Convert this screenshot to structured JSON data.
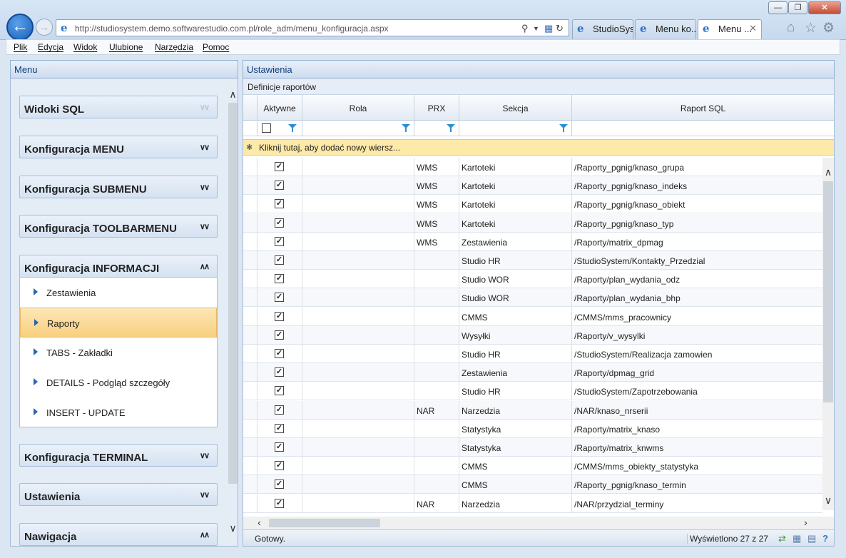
{
  "browser": {
    "url": "http://studiosystem.demo.softwarestudio.com.pl/role_adm/menu_konfiguracja.aspx",
    "tabs": [
      {
        "label": "StudioSys...",
        "active": false
      },
      {
        "label": "Menu ko...",
        "active": false
      },
      {
        "label": "Menu ...",
        "active": true
      }
    ],
    "window_buttons": {
      "minimize": "—",
      "maximize": "❐",
      "close": "✕"
    }
  },
  "menubar": [
    "Plik",
    "Edycja",
    "Widok",
    "Ulubione",
    "Narzędzia",
    "Pomoc"
  ],
  "left_panel": {
    "title": "Menu",
    "sections": [
      {
        "label": "Widoki SQL",
        "state": "collapsed"
      },
      {
        "label": "Konfiguracja MENU",
        "state": "collapsed"
      },
      {
        "label": "Konfiguracja SUBMENU",
        "state": "collapsed"
      },
      {
        "label": "Konfiguracja TOOLBARMENU",
        "state": "collapsed"
      },
      {
        "label": "Konfiguracja INFORMACJI",
        "state": "expanded"
      },
      {
        "label": "Konfiguracja TERMINAL",
        "state": "collapsed"
      },
      {
        "label": "Ustawienia",
        "state": "collapsed"
      },
      {
        "label": "Nawigacja",
        "state": "expanded"
      }
    ],
    "open_items": [
      {
        "label": "Zestawienia",
        "selected": false
      },
      {
        "label": "Raporty",
        "selected": true
      },
      {
        "label": "TABS - Zakładki",
        "selected": false
      },
      {
        "label": "DETAILS - Podgląd szczegóły",
        "selected": false
      },
      {
        "label": "INSERT - UPDATE",
        "selected": false
      }
    ]
  },
  "right_panel": {
    "title": "Ustawienia",
    "grid_caption": "Definicje raportów",
    "columns": [
      "Aktywne",
      "Rola",
      "PRX",
      "Sekcja",
      "Raport SQL"
    ],
    "new_row_text": "Kliknij tutaj, aby dodać nowy wiersz...",
    "rows": [
      {
        "aktywne": true,
        "rola": "",
        "prx": "WMS",
        "sekcja": "Kartoteki",
        "raport": "/Raporty_pgnig/knaso_grupa"
      },
      {
        "aktywne": true,
        "rola": "",
        "prx": "WMS",
        "sekcja": "Kartoteki",
        "raport": "/Raporty_pgnig/knaso_indeks"
      },
      {
        "aktywne": true,
        "rola": "",
        "prx": "WMS",
        "sekcja": "Kartoteki",
        "raport": "/Raporty_pgnig/knaso_obiekt"
      },
      {
        "aktywne": true,
        "rola": "",
        "prx": "WMS",
        "sekcja": "Kartoteki",
        "raport": "/Raporty_pgnig/knaso_typ"
      },
      {
        "aktywne": true,
        "rola": "",
        "prx": "WMS",
        "sekcja": "Zestawienia",
        "raport": "/Raporty/matrix_dpmag"
      },
      {
        "aktywne": true,
        "rola": "",
        "prx": "",
        "sekcja": "Studio HR",
        "raport": "/StudioSystem/Kontakty_Przedzial"
      },
      {
        "aktywne": true,
        "rola": "",
        "prx": "",
        "sekcja": "Studio WOR",
        "raport": "/Raporty/plan_wydania_odz"
      },
      {
        "aktywne": true,
        "rola": "",
        "prx": "",
        "sekcja": "Studio WOR",
        "raport": "/Raporty/plan_wydania_bhp"
      },
      {
        "aktywne": true,
        "rola": "",
        "prx": "",
        "sekcja": "CMMS",
        "raport": "/CMMS/mms_pracownicy"
      },
      {
        "aktywne": true,
        "rola": "",
        "prx": "",
        "sekcja": "Wysyłki",
        "raport": "/Raporty/v_wysylki"
      },
      {
        "aktywne": true,
        "rola": "",
        "prx": "",
        "sekcja": "Studio HR",
        "raport": "/StudioSystem/Realizacja zamowien"
      },
      {
        "aktywne": true,
        "rola": "",
        "prx": "",
        "sekcja": "Zestawienia",
        "raport": "/Raporty/dpmag_grid"
      },
      {
        "aktywne": true,
        "rola": "",
        "prx": "",
        "sekcja": "Studio HR",
        "raport": "/StudioSystem/Zapotrzebowania"
      },
      {
        "aktywne": true,
        "rola": "",
        "prx": "NAR",
        "sekcja": "Narzedzia",
        "raport": "/NAR/knaso_nrserii"
      },
      {
        "aktywne": true,
        "rola": "",
        "prx": "",
        "sekcja": "Statystyka",
        "raport": "/Raporty/matrix_knaso"
      },
      {
        "aktywne": true,
        "rola": "",
        "prx": "",
        "sekcja": "Statystyka",
        "raport": "/Raporty/matrix_knwms"
      },
      {
        "aktywne": true,
        "rola": "",
        "prx": "",
        "sekcja": "CMMS",
        "raport": "/CMMS/mms_obiekty_statystyka"
      },
      {
        "aktywne": true,
        "rola": "",
        "prx": "",
        "sekcja": "CMMS",
        "raport": "/Raporty_pgnig/knaso_termin"
      },
      {
        "aktywne": true,
        "rola": "",
        "prx": "NAR",
        "sekcja": "Narzedzia",
        "raport": "/NAR/przydzial_terminy"
      }
    ],
    "status_left": "Gotowy.",
    "status_right": "Wyświetlono 27 z 27"
  },
  "colors": {
    "accent": "#0f3d79",
    "selected": "#f8cf7f",
    "new_row": "#fde9a8"
  }
}
